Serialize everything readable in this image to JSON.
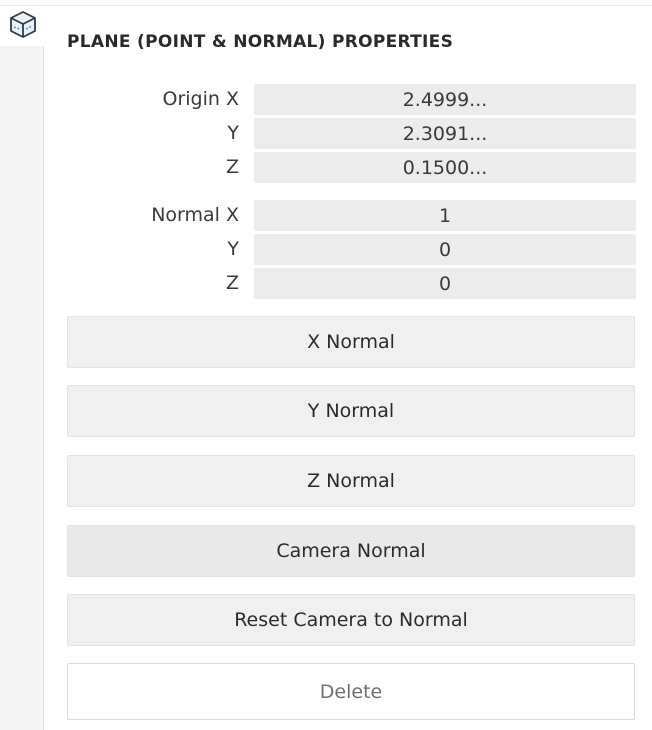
{
  "panel": {
    "title": "PLANE (POINT & NORMAL) PROPERTIES"
  },
  "origin": {
    "x_label": "Origin X",
    "y_label": "Y",
    "z_label": "Z",
    "x_value": "2.4999...",
    "y_value": "2.3091...",
    "z_value": "0.1500..."
  },
  "normal": {
    "x_label": "Normal X",
    "y_label": "Y",
    "z_label": "Z",
    "x_value": "1",
    "y_value": "0",
    "z_value": "0"
  },
  "buttons": {
    "x_normal": "X Normal",
    "y_normal": "Y Normal",
    "z_normal": "Z Normal",
    "camera_normal": "Camera Normal",
    "reset_camera": "Reset Camera to Normal",
    "delete": "Delete"
  },
  "sidebar": {
    "tab_icon": "cube-icon"
  }
}
